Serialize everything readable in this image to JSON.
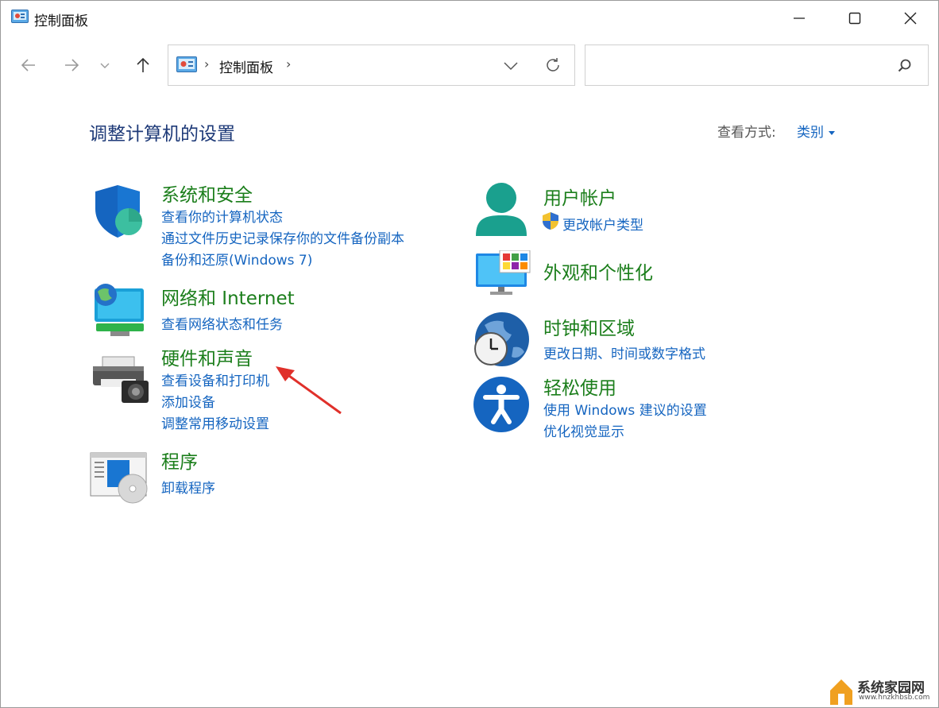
{
  "window": {
    "title": "控制面板",
    "controls": {
      "minimize": "minimize-icon",
      "maximize": "maximize-icon",
      "close": "close-icon"
    }
  },
  "nav": {
    "breadcrumb": [
      "控制面板"
    ],
    "search": {
      "placeholder": "",
      "value": ""
    }
  },
  "main": {
    "heading": "调整计算机的设置",
    "view_by_label": "查看方式:",
    "view_by_value": "类别",
    "categories_left": [
      {
        "title": "系统和安全",
        "icon": "shield-icon",
        "links": [
          "查看你的计算机状态",
          "通过文件历史记录保存你的文件备份副本",
          "备份和还原(Windows 7)"
        ]
      },
      {
        "title": "网络和 Internet",
        "icon": "network-globe-icon",
        "links": [
          "查看网络状态和任务"
        ]
      },
      {
        "title": "硬件和声音",
        "icon": "printer-icon",
        "links": [
          "查看设备和打印机",
          "添加设备",
          "调整常用移动设置"
        ]
      },
      {
        "title": "程序",
        "icon": "programs-disc-icon",
        "links": [
          "卸载程序"
        ]
      }
    ],
    "categories_right": [
      {
        "title": "用户帐户",
        "icon": "user-icon",
        "links": [
          "更改帐户类型"
        ]
      },
      {
        "title": "外观和个性化",
        "icon": "monitor-palette-icon",
        "links": []
      },
      {
        "title": "时钟和区域",
        "icon": "clock-globe-icon",
        "links": [
          "更改日期、时间或数字格式"
        ]
      },
      {
        "title": "轻松使用",
        "icon": "accessibility-icon",
        "links": [
          "使用 Windows 建议的设置",
          "优化视觉显示"
        ]
      }
    ]
  },
  "watermark": {
    "name": "系统家园网",
    "url": "www.hnzkhbsb.com"
  },
  "colors": {
    "heading": "#1e3a78",
    "category_title": "#1b7e1b",
    "link": "#1565c0",
    "arrow": "#e0302a"
  }
}
